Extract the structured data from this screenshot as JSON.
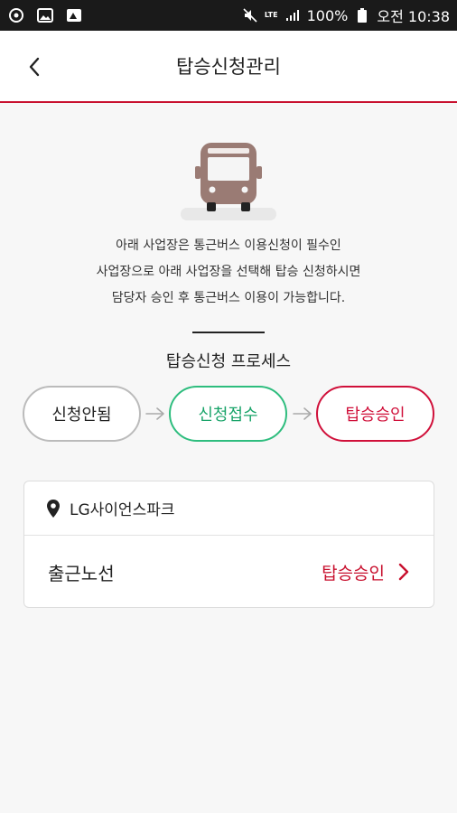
{
  "status_bar": {
    "battery": "100%",
    "time": "오전 10:38",
    "network": "LTE"
  },
  "header": {
    "title": "탑승신청관리"
  },
  "intro": {
    "line1": "아래 사업장은 통근버스 이용신청이 필수인",
    "line2": "사업장으로 아래 사업장을 선택해 탑승 신청하시면",
    "line3": "담당자 승인 후 통근버스 이용이 가능합니다."
  },
  "process": {
    "title": "탑승신청 프로세스",
    "steps": [
      "신청안됨",
      "신청접수",
      "탑승승인"
    ]
  },
  "workplace": {
    "name": "LG사이언스파크",
    "route_label": "출근노선",
    "route_status": "탑승승인"
  },
  "colors": {
    "accent_red": "#c8102e",
    "accent_green": "#2ebd7e",
    "bus_brown": "#9a7b74"
  }
}
